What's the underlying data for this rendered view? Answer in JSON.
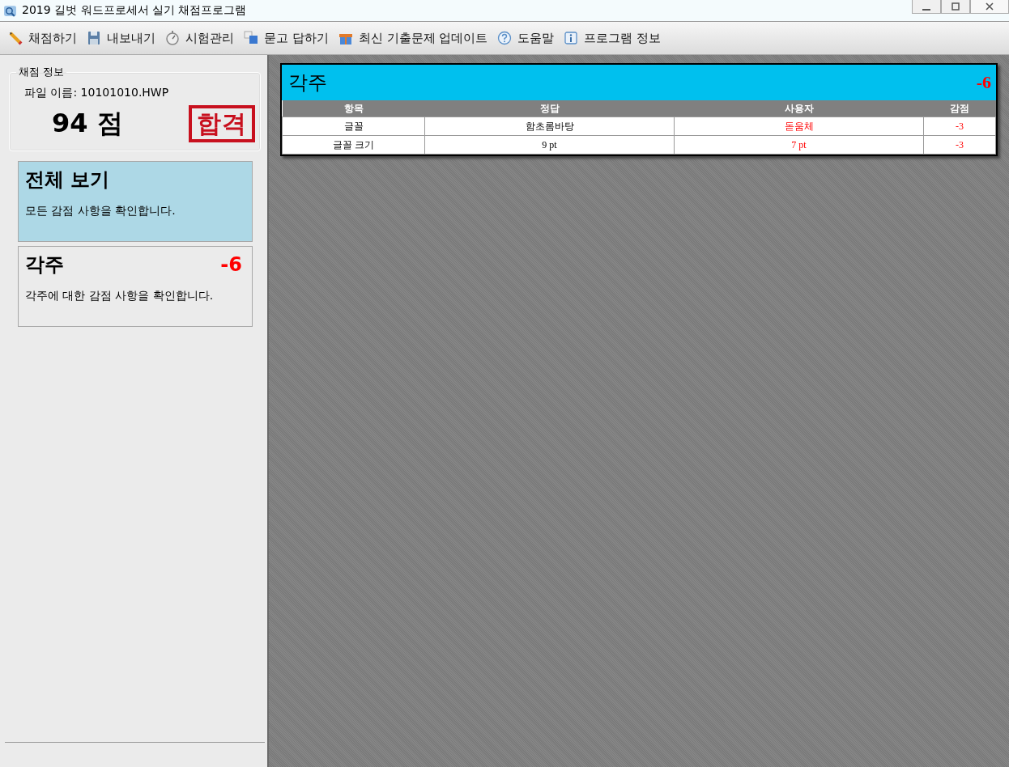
{
  "window": {
    "title": "2019 길벗 워드프로세서 실기 채점프로그램"
  },
  "toolbar": [
    "채점하기",
    "내보내기",
    "시험관리",
    "묻고 답하기",
    "최신 기출문제 업데이트",
    "도움말",
    "프로그램 정보"
  ],
  "score_info": {
    "legend": "채점 정보",
    "file_name": "파일 이름: 10101010.HWP",
    "score": "94 점",
    "stamp": "합격"
  },
  "categories": [
    {
      "title": "전체 보기",
      "description": "모든 감점 사항을 확인합니다.",
      "selected": true
    },
    {
      "title": "각주",
      "penalty": "-6",
      "description": "각주에 대한 감점 사항을 확인합니다.",
      "selected": false
    }
  ],
  "detail": {
    "title": "각주",
    "penalty": "-6",
    "columns": [
      "항목",
      "정답",
      "사용자",
      "감점"
    ],
    "rows": [
      {
        "item": "글꼴",
        "answer": "함초롬바탕",
        "user": "돋움체",
        "deduction": "-3"
      },
      {
        "item": "글꼴 크기",
        "answer": "9 pt",
        "user": "7 pt",
        "deduction": "-3"
      }
    ]
  }
}
